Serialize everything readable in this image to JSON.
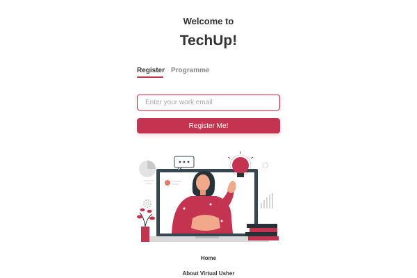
{
  "header": {
    "welcome_text": "Welcome to",
    "brand_name": "TechUp!"
  },
  "tabs": [
    {
      "label": "Register",
      "active": true
    },
    {
      "label": "Programme",
      "active": false
    }
  ],
  "form": {
    "email_placeholder": "Enter your work email",
    "email_value": "",
    "submit_label": "Register Me!"
  },
  "illustration": {
    "description_icon": "video-call-illustration-icon",
    "speech_bubble_text": "• • •"
  },
  "footer": {
    "home_label": "Home",
    "about_label": "About Virtual Usher"
  },
  "colors": {
    "accent": "#c4334f",
    "text": "#333333",
    "muted": "#8a8a8a",
    "monitor": "#37474f"
  }
}
